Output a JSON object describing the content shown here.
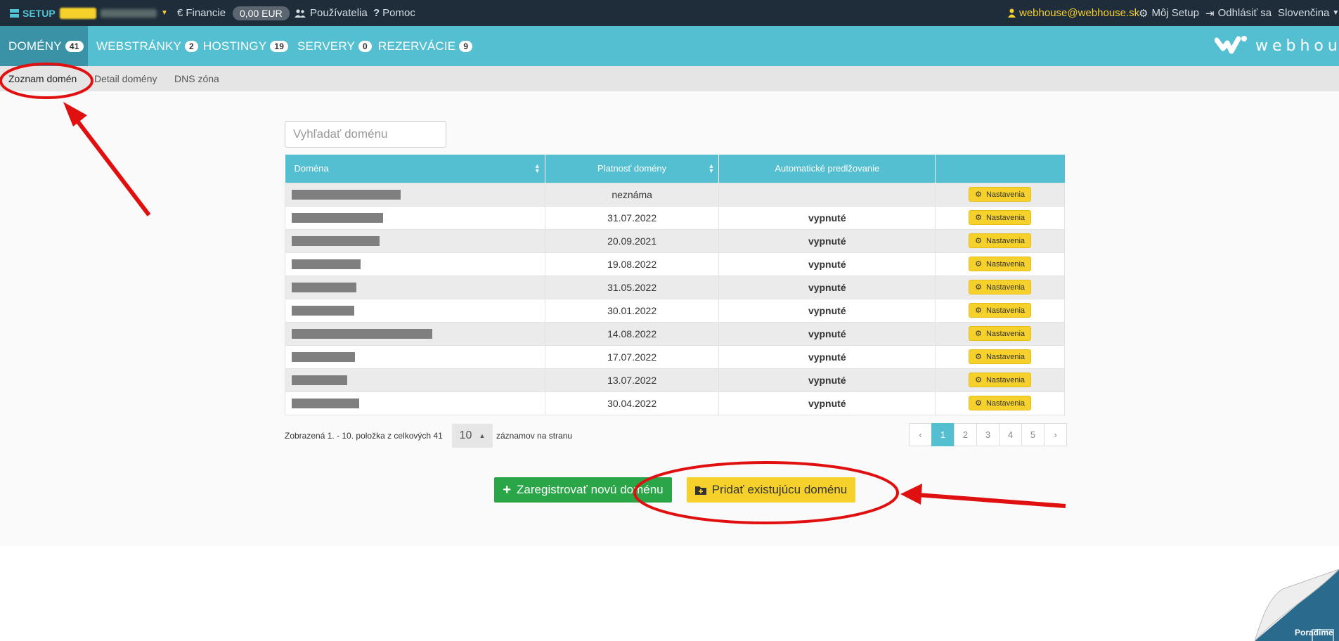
{
  "topbar": {
    "setup_label": "SETUP",
    "financie": "Financie",
    "balance": "0,00 EUR",
    "users": "Používatelia",
    "help": "Pomoc",
    "email": "webhouse@webhouse.sk",
    "my_setup": "Môj Setup",
    "logout": "Odhlásiť sa",
    "language": "Slovenčina"
  },
  "nav": {
    "tabs": [
      {
        "label": "DOMÉNY",
        "count": "41"
      },
      {
        "label": "WEBSTRÁNKY",
        "count": "2"
      },
      {
        "label": "HOSTINGY",
        "count": "19"
      },
      {
        "label": "SERVERY",
        "count": "0"
      },
      {
        "label": "REZERVÁCIE",
        "count": "9"
      }
    ],
    "logo_text": "webhouse"
  },
  "subnav": {
    "items": [
      "Zoznam domén",
      "Detail domény",
      "DNS zóna"
    ]
  },
  "search": {
    "placeholder": "Vyhľadať doménu"
  },
  "table": {
    "headers": [
      "Doména",
      "Platnosť domény",
      "Automatické predlžovanie",
      ""
    ],
    "action_label": "Nastavenia",
    "rows": [
      {
        "validity": "neznáma",
        "auto": ""
      },
      {
        "validity": "31.07.2022",
        "auto": "vypnuté"
      },
      {
        "validity": "20.09.2021",
        "auto": "vypnuté"
      },
      {
        "validity": "19.08.2022",
        "auto": "vypnuté"
      },
      {
        "validity": "31.05.2022",
        "auto": "vypnuté"
      },
      {
        "validity": "30.01.2022",
        "auto": "vypnuté"
      },
      {
        "validity": "14.08.2022",
        "auto": "vypnuté"
      },
      {
        "validity": "17.07.2022",
        "auto": "vypnuté"
      },
      {
        "validity": "13.07.2022",
        "auto": "vypnuté"
      },
      {
        "validity": "30.04.2022",
        "auto": "vypnuté"
      }
    ]
  },
  "pagination": {
    "info": "Zobrazená 1. - 10. položka z celkových 41",
    "per_page": "10",
    "per_page_label": "záznamov na stranu",
    "prev": "‹",
    "pages": [
      "1",
      "2",
      "3",
      "4",
      "5"
    ],
    "next": "›"
  },
  "actions": {
    "register": "Zaregistrovať novú doménu",
    "add_existing": "Pridať existujúcu doménu"
  },
  "corner": {
    "text": "Poradime"
  },
  "colors": {
    "accent": "#54bfd1",
    "topbar": "#1f2d3a",
    "green": "#2aa548",
    "yellow": "#f6d12c",
    "annotation_red": "#e01010"
  }
}
